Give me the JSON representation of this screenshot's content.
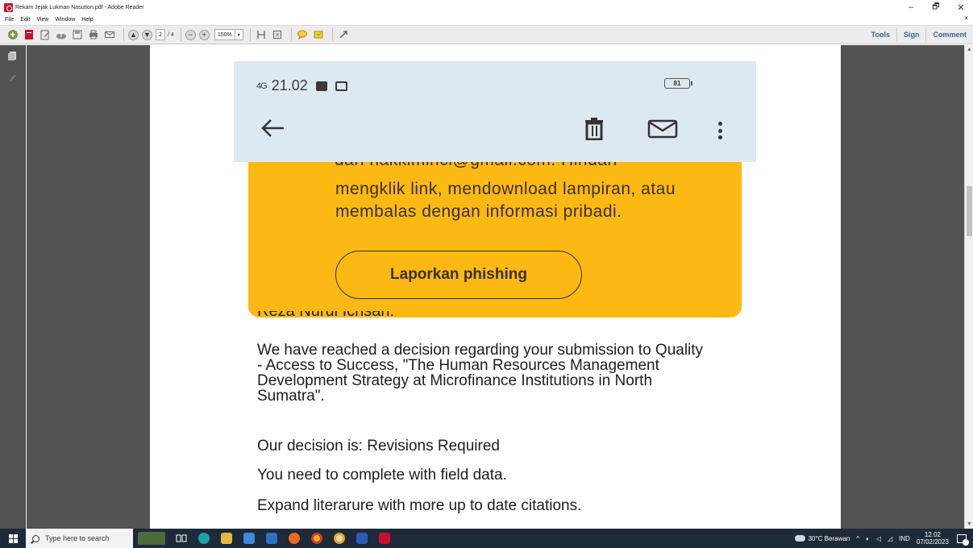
{
  "window": {
    "title": "Rekam Jejak Lukman Nasution.pdf - Adobe Reader",
    "controls": {
      "minimize": "–",
      "maximize": "🗗",
      "close": "✕"
    }
  },
  "menu": {
    "items": [
      "File",
      "Edit",
      "View",
      "Window",
      "Help"
    ],
    "close_doc": "×"
  },
  "toolbar": {
    "page_current": "2",
    "page_total": "/ 4",
    "zoom": "150%",
    "right_links": [
      "Tools",
      "Sign",
      "Comment"
    ]
  },
  "phone": {
    "network": "4G",
    "time": "21.02",
    "battery": "81"
  },
  "warning": {
    "cut_line": "dari hakkiminci@gmail.com. Hindari",
    "text": "mengklik link, mendownload lampiran, atau membalas dengan informasi pribadi.",
    "report_button": "Laporkan phishing"
  },
  "email": {
    "greeting_cut": "Reza Nurul Ichsan:",
    "paragraph": "We have reached a decision regarding your submission to Quality - Access to Success, \"The Human Resources Management Development Strategy at Microfinance Institutions in North Sumatra\".",
    "decision": "Our decision is: Revisions Required",
    "line2": "You need to complete with field data.",
    "line3": "Expand literarure with more up to date citations."
  },
  "taskbar": {
    "search_placeholder": "Type here to search",
    "weather": "30°C Berawan",
    "language": "IND",
    "time": "12.02",
    "date": "07/02/2023"
  },
  "colors": {
    "warning_bg": "#fdb913",
    "phone_header_bg": "#dce9f1",
    "reader_bg": "#535353",
    "taskbar_bg": "#1d2a3a",
    "link_blue": "#3c6596"
  }
}
